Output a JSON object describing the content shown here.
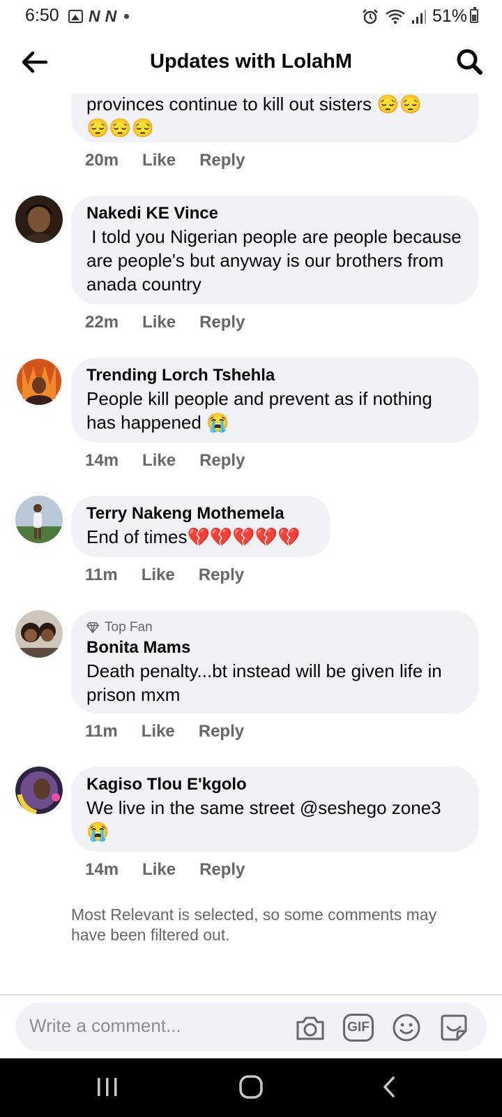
{
  "status_bar": {
    "time": "6:50",
    "carrier_icons": [
      "N",
      "N"
    ],
    "battery": "51%"
  },
  "header": {
    "title": "Updates with LolahM"
  },
  "comments": [
    {
      "author": "",
      "text": "provinces continue to kill out sisters",
      "emoji_line": "😔😔",
      "emoji_line2": "😔😔😔",
      "time": "20m",
      "like": "Like",
      "reply": "Reply"
    },
    {
      "author": "Nakedi KE Vince",
      "text": " I told you Nigerian people are people because are people's but anyway is our brothers from anada country",
      "time": "22m",
      "like": "Like",
      "reply": "Reply"
    },
    {
      "author": "Trending Lorch Tshehla",
      "text": "People kill people and prevent as if nothing has happened 😭",
      "time": "14m",
      "like": "Like",
      "reply": "Reply"
    },
    {
      "author": "Terry Nakeng Mothemela",
      "text": "End of times💔💔💔💔💔",
      "time": "11m",
      "like": "Like",
      "reply": "Reply"
    },
    {
      "badge": "Top Fan",
      "author": "Bonita Mams",
      "text": "Death penalty...bt instead will be given life in prison mxm",
      "time": "11m",
      "like": "Like",
      "reply": "Reply"
    },
    {
      "author": "Kagiso Tlou E'kgolo",
      "text": "We live in the same street @seshego zone3 😭",
      "time": "14m",
      "like": "Like",
      "reply": "Reply"
    }
  ],
  "footer_note": "Most Relevant is selected, so some comments may have been filtered out.",
  "composer": {
    "placeholder": "Write a comment...",
    "gif_label": "GIF"
  },
  "icons": {
    "back": "arrow-left-icon",
    "search": "search-icon",
    "camera": "camera-icon",
    "gif": "gif-icon",
    "emoji": "smiley-icon",
    "sticker": "sticker-icon"
  },
  "colors": {
    "bubble": "#f0f2f5",
    "meta_text": "#65676b",
    "text": "#050505"
  }
}
